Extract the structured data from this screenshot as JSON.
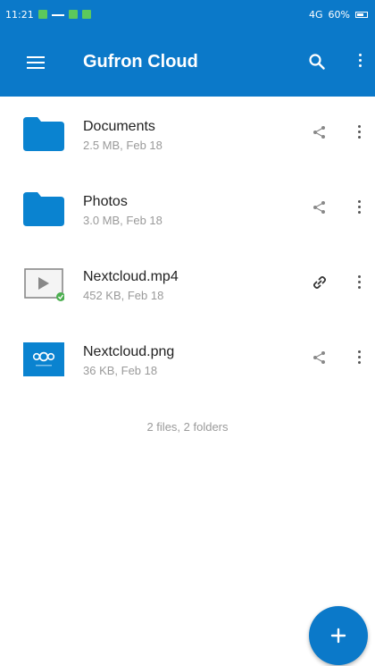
{
  "status_bar": {
    "time": "11:21",
    "network": "⇅ 4G",
    "signal": "4G",
    "battery": "60%"
  },
  "toolbar": {
    "title": "Gufron Cloud",
    "menu_icon": "hamburger-menu-icon",
    "search_icon": "search-icon",
    "more_icon": "more-vertical-icon"
  },
  "files": [
    {
      "name": "Documents",
      "meta": "2.5 MB, Feb 18",
      "kind": "folder",
      "action_icon": "share-icon"
    },
    {
      "name": "Photos",
      "meta": "3.0 MB, Feb 18",
      "kind": "folder",
      "action_icon": "share-icon"
    },
    {
      "name": "Nextcloud.mp4",
      "meta": "452 KB, Feb 18",
      "kind": "video",
      "action_icon": "link-icon"
    },
    {
      "name": "Nextcloud.png",
      "meta": "36 KB, Feb 18",
      "kind": "image",
      "action_icon": "share-icon"
    }
  ],
  "summary": "2 files, 2 folders",
  "fab": {
    "icon": "plus-icon"
  },
  "colors": {
    "primary": "#0b79c9",
    "folder": "#0a83d0",
    "sync_ok": "#4caf50"
  }
}
